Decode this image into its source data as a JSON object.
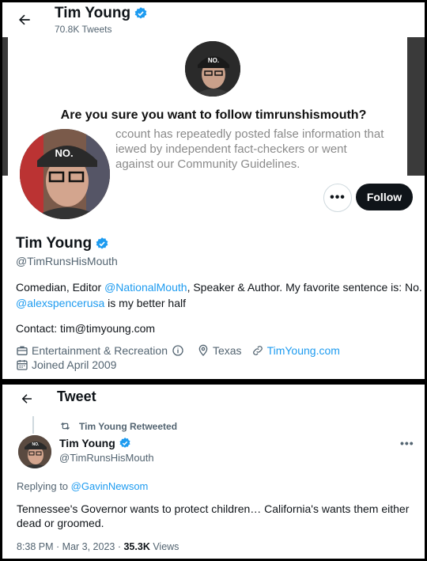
{
  "profile_header": {
    "name": "Tim Young",
    "tweet_count": "70.8K Tweets"
  },
  "follow_prompt": {
    "question": "Are you sure you want to follow timrunshismouth?",
    "warning_lines": [
      "ccount has repeatedly posted false information that",
      "iewed by independent fact-checkers or went",
      "against our Community Guidelines."
    ]
  },
  "buttons": {
    "more_label": "•••",
    "follow_label": "Follow"
  },
  "profile": {
    "name": "Tim Young",
    "handle": "@TimRunsHisMouth",
    "bio": {
      "part1": "Comedian, Editor ",
      "mention1": "@NationalMouth",
      "part2": ", Speaker & Author. My favorite sentence is: No.",
      "mention2": "@alexspencerusa",
      "part3": " is my better half"
    },
    "contact": "Contact: tim@timyoung.com",
    "category": "Entertainment & Recreation",
    "location": "Texas",
    "website": "TimYoung.com",
    "joined": "Joined April 2009"
  },
  "tweet_view": {
    "title": "Tweet",
    "retweeted_by": "Tim Young Retweeted",
    "author_name": "Tim Young",
    "author_handle": "@TimRunsHisMouth",
    "more_label": "•••",
    "replying_to_prefix": "Replying to ",
    "replying_to_handle": "@GavinNewsom",
    "text": "Tennessee's Governor wants to protect children… California's wants them either dead or groomed.",
    "time": "8:38 PM · Mar 3, 2023 · ",
    "views_count": "35.3K",
    "views_label": " Views"
  },
  "colors": {
    "link": "#1d9bf0",
    "verified": "#1d9bf0",
    "follow_button": "#0f1419",
    "secondary_text": "#536471"
  },
  "icons": [
    "back-arrow-icon",
    "verified-badge-icon",
    "briefcase-icon",
    "info-icon",
    "location-pin-icon",
    "link-icon",
    "calendar-icon",
    "retweet-icon"
  ]
}
